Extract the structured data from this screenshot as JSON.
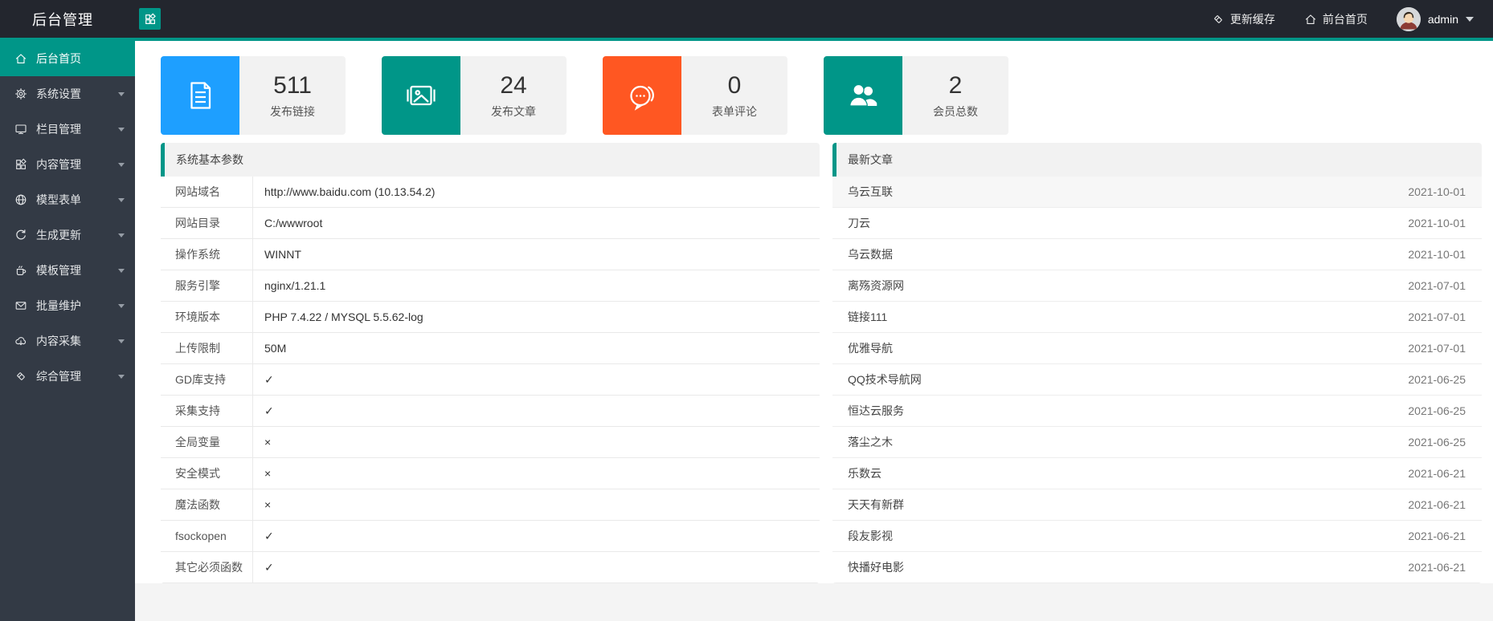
{
  "header": {
    "app_title": "后台管理",
    "refresh_cache_label": "更新缓存",
    "front_home_label": "前台首页",
    "username": "admin"
  },
  "sidebar": {
    "items": [
      {
        "label": "后台首页",
        "icon": "home-icon",
        "active": true,
        "has_children": false
      },
      {
        "label": "系统设置",
        "icon": "gear-icon",
        "active": false,
        "has_children": true
      },
      {
        "label": "栏目管理",
        "icon": "monitor-icon",
        "active": false,
        "has_children": true
      },
      {
        "label": "内容管理",
        "icon": "grid-icon",
        "active": false,
        "has_children": true
      },
      {
        "label": "模型表单",
        "icon": "globe-icon",
        "active": false,
        "has_children": true
      },
      {
        "label": "生成更新",
        "icon": "refresh-icon",
        "active": false,
        "has_children": true
      },
      {
        "label": "模板管理",
        "icon": "cup-icon",
        "active": false,
        "has_children": true
      },
      {
        "label": "批量维护",
        "icon": "mail-icon",
        "active": false,
        "has_children": true
      },
      {
        "label": "内容采集",
        "icon": "cloud-download-icon",
        "active": false,
        "has_children": true
      },
      {
        "label": "综合管理",
        "icon": "eraser-icon",
        "active": false,
        "has_children": true
      }
    ]
  },
  "stats": [
    {
      "value": "511",
      "label": "发布链接",
      "icon": "document-icon",
      "color": "#1E9FFF"
    },
    {
      "value": "24",
      "label": "发布文章",
      "icon": "image-icon",
      "color": "#009688"
    },
    {
      "value": "0",
      "label": "表单评论",
      "icon": "comment-icon",
      "color": "#FF5722"
    },
    {
      "value": "2",
      "label": "会员总数",
      "icon": "users-icon",
      "color": "#009688"
    }
  ],
  "system_panel": {
    "title": "系统基本参数",
    "rows": [
      {
        "label": "网站域名",
        "value": "http://www.baidu.com (10.13.54.2)"
      },
      {
        "label": "网站目录",
        "value": "C:/wwwroot"
      },
      {
        "label": "操作系统",
        "value": "WINNT"
      },
      {
        "label": "服务引擎",
        "value": "nginx/1.21.1"
      },
      {
        "label": "环境版本",
        "value": "PHP 7.4.22 / MYSQL 5.5.62-log"
      },
      {
        "label": "上传限制",
        "value": "50M"
      },
      {
        "label": "GD库支持",
        "value": "✓"
      },
      {
        "label": "采集支持",
        "value": "✓"
      },
      {
        "label": "全局变量",
        "value": "×"
      },
      {
        "label": "安全模式",
        "value": "×"
      },
      {
        "label": "魔法函数",
        "value": "×"
      },
      {
        "label": "fsockopen",
        "value": "✓"
      },
      {
        "label": "其它必须函数",
        "value": "✓"
      }
    ]
  },
  "articles_panel": {
    "title": "最新文章",
    "items": [
      {
        "title": "乌云互联",
        "date": "2021-10-01"
      },
      {
        "title": "刀云",
        "date": "2021-10-01"
      },
      {
        "title": "乌云数据",
        "date": "2021-10-01"
      },
      {
        "title": "离殇资源网",
        "date": "2021-07-01"
      },
      {
        "title": "链接111",
        "date": "2021-07-01"
      },
      {
        "title": "优雅导航",
        "date": "2021-07-01"
      },
      {
        "title": "QQ技术导航网",
        "date": "2021-06-25"
      },
      {
        "title": "恒达云服务",
        "date": "2021-06-25"
      },
      {
        "title": "落尘之木",
        "date": "2021-06-25"
      },
      {
        "title": "乐数云",
        "date": "2021-06-21"
      },
      {
        "title": "天天有新群",
        "date": "2021-06-21"
      },
      {
        "title": "段友影视",
        "date": "2021-06-21"
      },
      {
        "title": "快播好电影",
        "date": "2021-06-21"
      }
    ]
  },
  "colors": {
    "accent_teal": "#009688",
    "accent_blue": "#1E9FFF",
    "accent_orange": "#FF5722",
    "header_bg": "#23262e",
    "sidebar_bg": "#333a45"
  }
}
